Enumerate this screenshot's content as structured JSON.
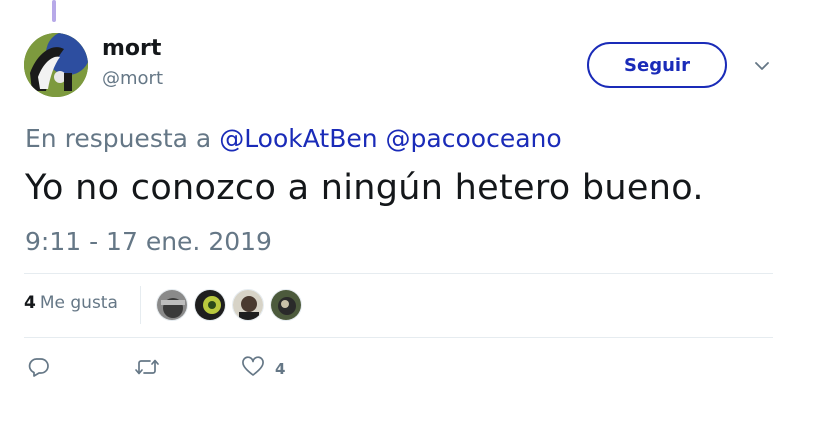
{
  "tweet": {
    "author": {
      "name": "mort",
      "handle": "@mort"
    },
    "follow_label": "Seguir",
    "reply": {
      "prefix": "En respuesta a",
      "mentions": [
        "@LookAtBen",
        "@pacooceano"
      ]
    },
    "text": "Yo no conozco a ningún hetero bueno.",
    "timestamp": "9:11 - 17 ene. 2019",
    "stats": {
      "likes_count": "4",
      "likes_label": "Me gusta"
    },
    "actions": {
      "like_count": "4"
    }
  },
  "icons": [
    "chevron-down-icon",
    "reply-icon",
    "retweet-icon",
    "heart-icon"
  ],
  "colors": {
    "accent": "#1a2bb8",
    "muted": "#657786",
    "text": "#14171a",
    "divider": "#e6ecf0"
  }
}
